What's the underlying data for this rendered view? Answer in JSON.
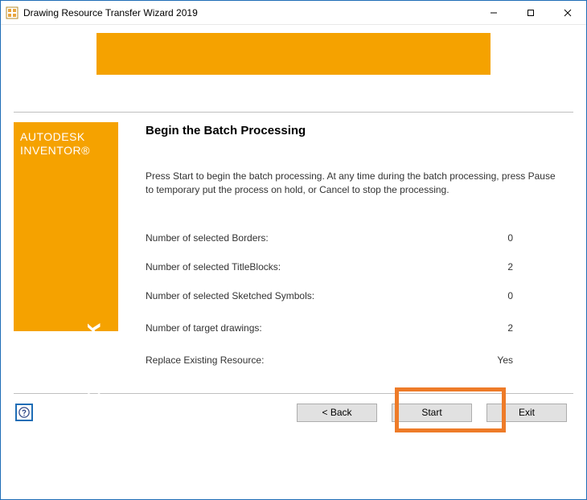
{
  "window": {
    "title": "Drawing Resource Transfer Wizard 2019"
  },
  "brand": {
    "line1": "AUTODESK",
    "line2": "INVENTOR®",
    "side": "Autodesk"
  },
  "main": {
    "heading": "Begin the Batch Processing",
    "description": "Press Start to begin the batch processing. At any time during the batch processing, press Pause to temporary put the process on hold, or Cancel to stop the processing.",
    "rows": {
      "borders_label": "Number of selected Borders:",
      "borders_value": "0",
      "titleblocks_label": "Number of selected TitleBlocks:",
      "titleblocks_value": "2",
      "symbols_label": "Number of selected Sketched Symbols:",
      "symbols_value": "0",
      "targets_label": "Number of target drawings:",
      "targets_value": "2",
      "replace_label": "Replace Existing Resource:",
      "replace_value": "Yes"
    }
  },
  "footer": {
    "back": "< Back",
    "start": "Start",
    "exit": "Exit"
  }
}
